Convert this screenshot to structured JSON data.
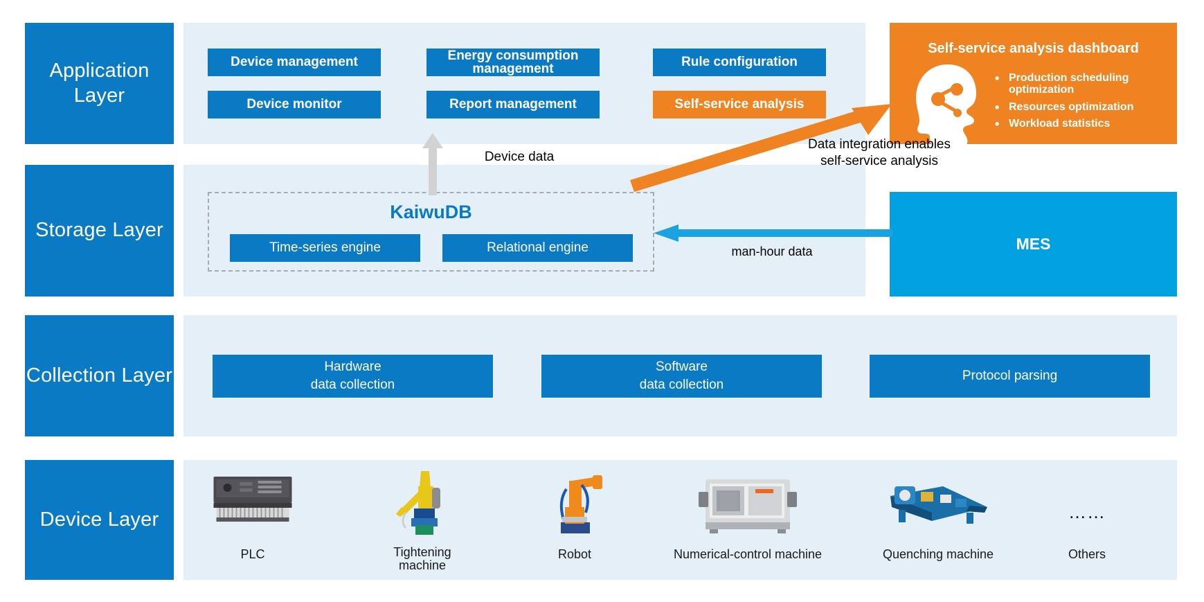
{
  "diagram": {
    "title": "Industrial IoT layered architecture with KaiwuDB",
    "colors": {
      "band": "#e4eff8",
      "blue": "#0b7ac4",
      "orange": "#ef8321",
      "cyan": "#00a0e1",
      "gray_arrow": "#d2d2d2",
      "dashed_border": "#a8abad"
    }
  },
  "layers": [
    {
      "id": "application",
      "label": "Application\nLayer"
    },
    {
      "id": "storage",
      "label": "Storage\nLayer"
    },
    {
      "id": "collection",
      "label": "Collection\nLayer"
    },
    {
      "id": "device",
      "label": "Device\nLayer"
    }
  ],
  "application": {
    "modules": [
      {
        "label": "Device management",
        "accent": "blue"
      },
      {
        "label": "Device monitor",
        "accent": "blue"
      },
      {
        "label": "Energy consumption\nmanagement",
        "accent": "blue"
      },
      {
        "label": "Report management",
        "accent": "blue"
      },
      {
        "label": "Rule configuration",
        "accent": "blue"
      },
      {
        "label": "Self-service analysis",
        "accent": "orange"
      }
    ]
  },
  "dashboard": {
    "title": "Self-service analysis dashboard",
    "icon": "head-network-icon",
    "bullets": [
      "Production scheduling optimization",
      "Resources optimization",
      "Workload statistics"
    ]
  },
  "storage": {
    "group_title": "KaiwuDB",
    "engines": [
      {
        "label": "Time-series engine"
      },
      {
        "label": "Relational engine"
      }
    ],
    "mes": {
      "label": "MES"
    }
  },
  "annotations": {
    "device_data": "Device data",
    "integration": "Data integration enables\nself-service analysis",
    "man_hour": "man-hour data"
  },
  "collection": {
    "modules": [
      {
        "label": "Hardware\ndata collection"
      },
      {
        "label": "Software\ndata collection"
      },
      {
        "label": "Protocol parsing"
      }
    ]
  },
  "device": {
    "items": [
      {
        "label": "PLC",
        "icon": "plc-icon"
      },
      {
        "label": "Tightening\nmachine",
        "icon": "tightening-machine-icon"
      },
      {
        "label": "Robot",
        "icon": "robot-icon"
      },
      {
        "label": "Numerical-control machine",
        "icon": "cnc-machine-icon"
      },
      {
        "label": "Quenching machine",
        "icon": "quenching-machine-icon"
      },
      {
        "label": "Others",
        "icon": "ellipsis-icon"
      }
    ],
    "ellipsis": "……"
  }
}
